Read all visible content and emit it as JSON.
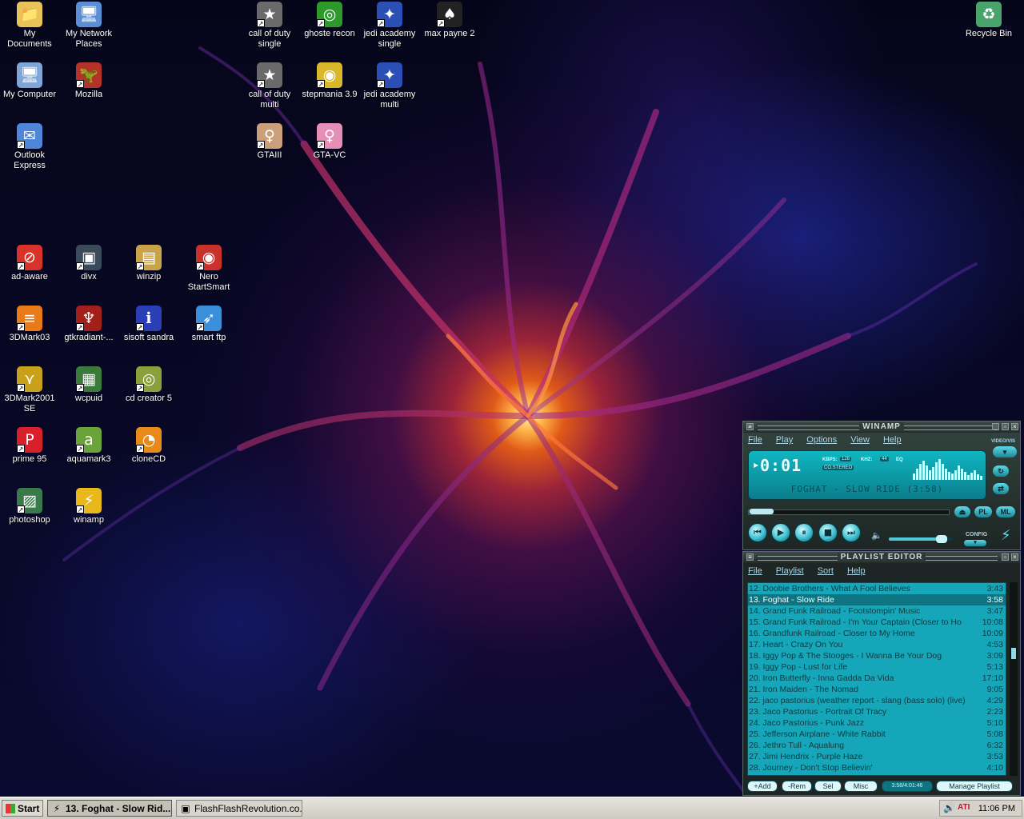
{
  "desktop": {
    "icons": [
      {
        "label": "My Documents",
        "glyph": "📁",
        "color": "#e8c35a",
        "shortcut": false
      },
      {
        "label": "My Network Places",
        "glyph": "🖥",
        "color": "#5a8fd8",
        "shortcut": false
      },
      {
        "label": "My Computer",
        "glyph": "🖥",
        "color": "#7fa6d6",
        "shortcut": false
      },
      {
        "label": "Mozilla",
        "glyph": "🦖",
        "color": "#b5322a",
        "shortcut": true
      },
      {
        "label": "Outlook Express",
        "glyph": "✉",
        "color": "#4f86d9",
        "shortcut": true
      },
      {
        "label": "call of duty single",
        "glyph": "★",
        "color": "#6a6a6a",
        "shortcut": true
      },
      {
        "label": "ghoste recon",
        "glyph": "◎",
        "color": "#2b9a2b",
        "shortcut": true
      },
      {
        "label": "jedi academy single",
        "glyph": "✦",
        "color": "#2b4fb5",
        "shortcut": true
      },
      {
        "label": "max payne 2",
        "glyph": "♠",
        "color": "#222222",
        "shortcut": true
      },
      {
        "label": "call of duty multi",
        "glyph": "★",
        "color": "#6a6a6a",
        "shortcut": true
      },
      {
        "label": "stepmania 3.9",
        "glyph": "◉",
        "color": "#d8b82a",
        "shortcut": true
      },
      {
        "label": "jedi academy multi",
        "glyph": "✦",
        "color": "#2b4fb5",
        "shortcut": true
      },
      {
        "label": "GTAIII",
        "glyph": "♀",
        "color": "#c9a07a",
        "shortcut": true
      },
      {
        "label": "GTA-VC",
        "glyph": "♀",
        "color": "#e58fb8",
        "shortcut": true
      },
      {
        "label": "Recycle Bin",
        "glyph": "♻",
        "color": "#4aa36a",
        "shortcut": false
      },
      {
        "label": "ad-aware",
        "glyph": "⊘",
        "color": "#d8322a",
        "shortcut": true
      },
      {
        "label": "divx",
        "glyph": "▣",
        "color": "#3a4a5a",
        "shortcut": true
      },
      {
        "label": "winzip",
        "glyph": "▤",
        "color": "#c9a34a",
        "shortcut": true
      },
      {
        "label": "Nero StartSmart",
        "glyph": "◉",
        "color": "#c9322a",
        "shortcut": true
      },
      {
        "label": "3DMark03",
        "glyph": "≡",
        "color": "#e87a1a",
        "shortcut": true
      },
      {
        "label": "gtkradiant-...",
        "glyph": "♆",
        "color": "#a3201a",
        "shortcut": true
      },
      {
        "label": "sisoft sandra",
        "glyph": "ℹ",
        "color": "#2a3fb5",
        "shortcut": true
      },
      {
        "label": "smart ftp",
        "glyph": "➶",
        "color": "#3a8fd8",
        "shortcut": true
      },
      {
        "label": "3DMark2001 SE",
        "glyph": "⋎",
        "color": "#c9a01a",
        "shortcut": true
      },
      {
        "label": "wcpuid",
        "glyph": "▦",
        "color": "#3a7a3a",
        "shortcut": true
      },
      {
        "label": "cd creator 5",
        "glyph": "◎",
        "color": "#8aa03a",
        "shortcut": true
      },
      {
        "label": "prime 95",
        "glyph": "P",
        "color": "#d8202a",
        "shortcut": true
      },
      {
        "label": "aquamark3",
        "glyph": "a",
        "color": "#6aa33a",
        "shortcut": true
      },
      {
        "label": "cloneCD",
        "glyph": "◔",
        "color": "#e88a1a",
        "shortcut": true
      },
      {
        "label": "photoshop",
        "glyph": "▨",
        "color": "#3a7a4a",
        "shortcut": true
      },
      {
        "label": "winamp",
        "glyph": "⚡",
        "color": "#e8b81a",
        "shortcut": true
      }
    ]
  },
  "winamp": {
    "title": "WINAMP",
    "menu": [
      "File",
      "Play",
      "Options",
      "View",
      "Help"
    ],
    "time": "0:01",
    "kbps_label": "KBPS:",
    "kbps": "128",
    "khz_label": "KHZ:",
    "khz": "44",
    "mode": "CO.STEREO",
    "eq_label": "EQ",
    "song": "FOGHAT - SLOW RIDE (3:58)",
    "side_label": "VIDEO/VIS",
    "config_label": "CONFIG",
    "pl_button": "PL",
    "ml_button": "ML",
    "seek_fraction": 0.004,
    "volume_fraction": 0.9
  },
  "playlist": {
    "title": "PLAYLIST EDITOR",
    "menu": [
      "File",
      "Playlist",
      "Sort",
      "Help"
    ],
    "current_index": 1,
    "tracks": [
      {
        "title": "12. Doobie Brothers - What A Fool Believes",
        "dur": "3:43"
      },
      {
        "title": "13. Foghat - Slow Ride",
        "dur": "3:58"
      },
      {
        "title": "14. Grand Funk Railroad - Footstompin' Music",
        "dur": "3:47"
      },
      {
        "title": "15. Grand Funk Railroad - I'm Your Captain (Closer to Ho",
        "dur": "10:08"
      },
      {
        "title": "16. Grandfunk Railroad - Closer to My Home",
        "dur": "10:09"
      },
      {
        "title": "17. Heart - Crazy On You",
        "dur": "4:53"
      },
      {
        "title": "18. Iggy Pop & The Stooges - I Wanna Be Your Dog",
        "dur": "3:09"
      },
      {
        "title": "19. Iggy Pop - Lust for Life",
        "dur": "5:13"
      },
      {
        "title": "20. Iron Butterfly - Inna Gadda Da Vida",
        "dur": "17:10"
      },
      {
        "title": "21. Iron Maiden - The Nomad",
        "dur": "9:05"
      },
      {
        "title": "22. jaco pastorius (weather report - slang (bass solo) (live)",
        "dur": "4:29"
      },
      {
        "title": "23. Jaco Pastorius - Portrait Of Tracy",
        "dur": "2:23"
      },
      {
        "title": "24. Jaco Pastorius - Punk Jazz",
        "dur": "5:10"
      },
      {
        "title": "25. Jefferson Airplane - White Rabbit",
        "dur": "5:08"
      },
      {
        "title": "26. Jethro Tull - Aqualung",
        "dur": "6:32"
      },
      {
        "title": "27. Jimi Hendrix - Purple Haze",
        "dur": "3:53"
      },
      {
        "title": "28. Journey - Don't Stop Believin'",
        "dur": "4:10"
      }
    ],
    "buttons": {
      "add": "+Add",
      "rem": "-Rem",
      "sel": "Sel",
      "misc": "Misc",
      "manage": "Manage Playlist"
    },
    "time_display": "3:58/4:01:46"
  },
  "taskbar": {
    "start_label": "Start",
    "tasks": [
      {
        "label": "13. Foghat - Slow Rid...",
        "icon": "⚡",
        "active": true
      },
      {
        "label": "FlashFlashRevolution.co...",
        "icon": "▣",
        "active": false
      }
    ],
    "tray_ati": "ATI",
    "clock": "11:06 PM"
  },
  "colors": {
    "accent": "#15a7b9",
    "current_row": "#0e7482"
  }
}
